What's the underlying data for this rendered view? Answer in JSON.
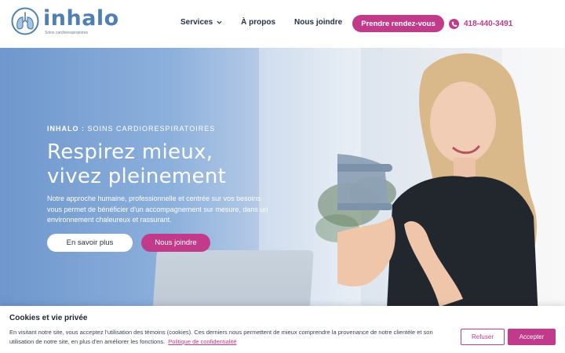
{
  "header": {
    "logo": {
      "name": "inhalo",
      "tagline": "Soins cardiorespiratoires",
      "icon": "lungs-icon",
      "color": "#4f7fb4"
    },
    "nav": [
      {
        "label": "Services",
        "icon": "chevron-down-icon"
      },
      {
        "label": "À propos"
      },
      {
        "label": "Nous joindre"
      }
    ],
    "cta_label": "Prendre rendez-vous",
    "phone": {
      "icon": "phone-icon",
      "number": "418-440-3491"
    }
  },
  "hero": {
    "eyebrow_brand": "INHALO :",
    "eyebrow_rest": " SOINS CARDIORESPIRATOIRES",
    "title_line1": "Respirez mieux,",
    "title_line2": "vivez pleinement",
    "description": "Notre approche humaine, professionnelle et centrée sur vos besoins vous permet de bénéficier d'un accompagnement sur mesure, dans un environnement chaleureux et rassurant.",
    "primary_button": "En savoir plus",
    "secondary_button": "Nous joindre"
  },
  "cookie": {
    "title": "Cookies et vie privée",
    "text": "En visitant notre site, vous acceptez l'utilisation des témoins (cookies). Ces derniers nous permettent de mieux comprendre la provenance de notre clientèle et son utilisation de notre site, en plus d'en améliorer les fonctions.",
    "policy_link": "Politique de confidentialité",
    "refuse_label": "Refuser",
    "accept_label": "Accepter"
  },
  "colors": {
    "accent": "#c13b8a",
    "brand_blue": "#4f7fb4",
    "nav_text": "#23334a"
  }
}
